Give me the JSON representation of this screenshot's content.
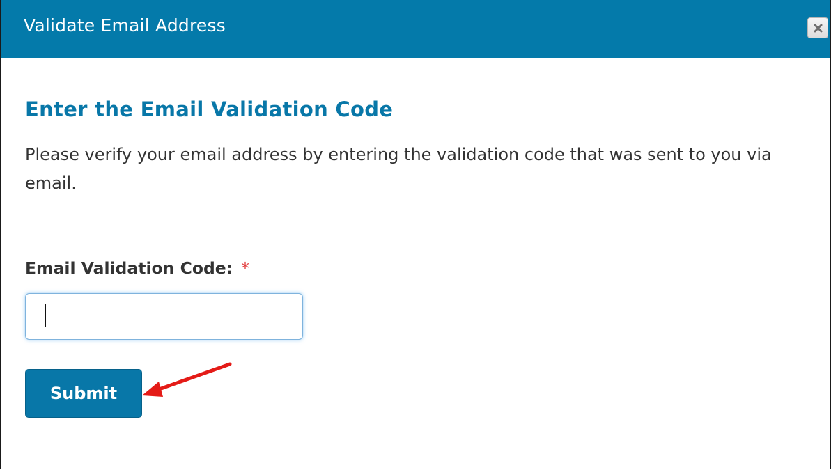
{
  "dialog": {
    "title": "Validate Email Address",
    "close_icon": "close-x-icon"
  },
  "content": {
    "heading": "Enter the Email Validation Code",
    "description": "Please verify your email address by entering the validation code that was sent to you via email.",
    "field_label": "Email Validation Code:",
    "required_marker": "*",
    "input_value": "",
    "submit_label": "Submit"
  },
  "annotation": {
    "arrow_icon": "red-arrow-icon",
    "arrow_color": "#e41b17"
  },
  "colors": {
    "titlebar": "#047aaa",
    "heading": "#0877a8",
    "button": "#0877a8",
    "required": "#e23b3b"
  }
}
